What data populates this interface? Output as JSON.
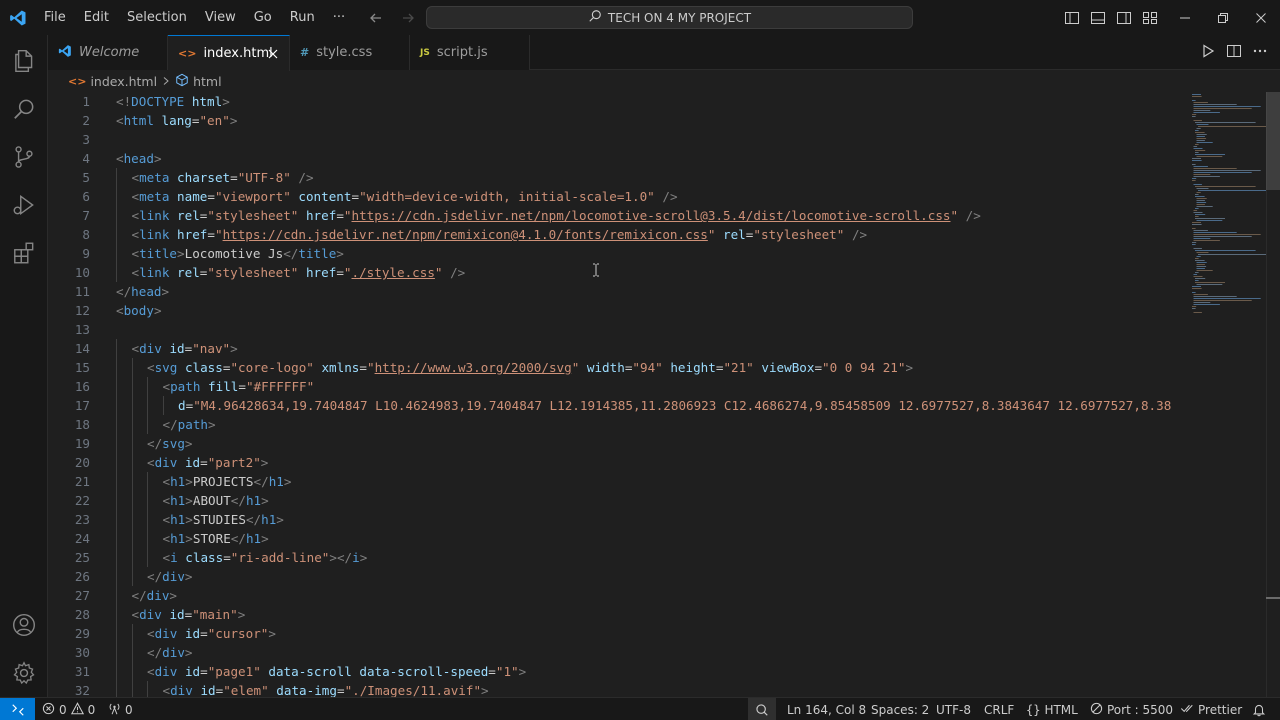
{
  "menu": [
    "File",
    "Edit",
    "Selection",
    "View",
    "Go",
    "Run",
    "···"
  ],
  "command_center": {
    "label": "TECH ON 4 MY PROJECT"
  },
  "tabs": [
    {
      "label": "Welcome",
      "icon": "vscode-logo-icon",
      "italic": true,
      "active": false
    },
    {
      "label": "index.html",
      "icon": "html-file-icon",
      "italic": false,
      "active": true
    },
    {
      "label": "style.css",
      "icon": "css-file-icon",
      "italic": false,
      "active": false
    },
    {
      "label": "script.js",
      "icon": "js-file-icon",
      "italic": false,
      "active": false
    }
  ],
  "tab_icons": {
    "html": "<>",
    "css": "#",
    "js": "JS"
  },
  "breadcrumb": {
    "file": "index.html",
    "symbol": "html"
  },
  "code": [
    {
      "n": "1",
      "tokens": [
        [
          "br",
          "<!"
        ],
        [
          "tag",
          "DOCTYPE"
        ],
        [
          "text",
          " "
        ],
        [
          "attr",
          "html"
        ],
        [
          "br",
          ">"
        ]
      ]
    },
    {
      "n": "2",
      "tokens": [
        [
          "br",
          "<"
        ],
        [
          "tag",
          "html"
        ],
        [
          "text",
          " "
        ],
        [
          "attr",
          "lang"
        ],
        [
          "text",
          "="
        ],
        [
          "str",
          "\"en\""
        ],
        [
          "br",
          ">"
        ]
      ]
    },
    {
      "n": "3",
      "tokens": []
    },
    {
      "n": "4",
      "tokens": [
        [
          "br",
          "<"
        ],
        [
          "tag",
          "head"
        ],
        [
          "br",
          ">"
        ]
      ]
    },
    {
      "n": "5",
      "indent": 1,
      "tokens": [
        [
          "br",
          "<"
        ],
        [
          "tag",
          "meta"
        ],
        [
          "text",
          " "
        ],
        [
          "attr",
          "charset"
        ],
        [
          "text",
          "="
        ],
        [
          "str",
          "\"UTF-8\""
        ],
        [
          "text",
          " "
        ],
        [
          "br",
          "/>"
        ]
      ]
    },
    {
      "n": "6",
      "indent": 1,
      "tokens": [
        [
          "br",
          "<"
        ],
        [
          "tag",
          "meta"
        ],
        [
          "text",
          " "
        ],
        [
          "attr",
          "name"
        ],
        [
          "text",
          "="
        ],
        [
          "str",
          "\"viewport\""
        ],
        [
          "text",
          " "
        ],
        [
          "attr",
          "content"
        ],
        [
          "text",
          "="
        ],
        [
          "str",
          "\"width=device-width, initial-scale=1.0\""
        ],
        [
          "text",
          " "
        ],
        [
          "br",
          "/>"
        ]
      ]
    },
    {
      "n": "7",
      "indent": 1,
      "tokens": [
        [
          "br",
          "<"
        ],
        [
          "tag",
          "link"
        ],
        [
          "text",
          " "
        ],
        [
          "attr",
          "rel"
        ],
        [
          "text",
          "="
        ],
        [
          "str",
          "\"stylesheet\""
        ],
        [
          "text",
          " "
        ],
        [
          "attr",
          "href"
        ],
        [
          "text",
          "="
        ],
        [
          "str",
          "\""
        ],
        [
          "link",
          "https://cdn.jsdelivr.net/npm/locomotive-scroll@3.5.4/dist/locomotive-scroll.css"
        ],
        [
          "str",
          "\""
        ],
        [
          "text",
          " "
        ],
        [
          "br",
          "/>"
        ]
      ]
    },
    {
      "n": "8",
      "indent": 1,
      "tokens": [
        [
          "br",
          "<"
        ],
        [
          "tag",
          "link"
        ],
        [
          "text",
          " "
        ],
        [
          "attr",
          "href"
        ],
        [
          "text",
          "="
        ],
        [
          "str",
          "\""
        ],
        [
          "link",
          "https://cdn.jsdelivr.net/npm/remixicon@4.1.0/fonts/remixicon.css"
        ],
        [
          "str",
          "\""
        ],
        [
          "text",
          " "
        ],
        [
          "attr",
          "rel"
        ],
        [
          "text",
          "="
        ],
        [
          "str",
          "\"stylesheet\""
        ],
        [
          "text",
          " "
        ],
        [
          "br",
          "/>"
        ]
      ]
    },
    {
      "n": "9",
      "indent": 1,
      "tokens": [
        [
          "br",
          "<"
        ],
        [
          "tag",
          "title"
        ],
        [
          "br",
          ">"
        ],
        [
          "text",
          "Locomotive Js"
        ],
        [
          "br",
          "</"
        ],
        [
          "tag",
          "title"
        ],
        [
          "br",
          ">"
        ]
      ]
    },
    {
      "n": "10",
      "indent": 1,
      "tokens": [
        [
          "br",
          "<"
        ],
        [
          "tag",
          "link"
        ],
        [
          "text",
          " "
        ],
        [
          "attr",
          "rel"
        ],
        [
          "text",
          "="
        ],
        [
          "str",
          "\"stylesheet\""
        ],
        [
          "text",
          " "
        ],
        [
          "attr",
          "href"
        ],
        [
          "text",
          "="
        ],
        [
          "str",
          "\""
        ],
        [
          "link",
          "./style.css"
        ],
        [
          "str",
          "\""
        ],
        [
          "text",
          " "
        ],
        [
          "br",
          "/>"
        ]
      ]
    },
    {
      "n": "11",
      "tokens": [
        [
          "br",
          "</"
        ],
        [
          "tag",
          "head"
        ],
        [
          "br",
          ">"
        ]
      ]
    },
    {
      "n": "12",
      "tokens": [
        [
          "br",
          "<"
        ],
        [
          "tag",
          "body"
        ],
        [
          "br",
          ">"
        ]
      ]
    },
    {
      "n": "13",
      "tokens": []
    },
    {
      "n": "14",
      "indent": 1,
      "tokens": [
        [
          "br",
          "<"
        ],
        [
          "tag",
          "div"
        ],
        [
          "text",
          " "
        ],
        [
          "attr",
          "id"
        ],
        [
          "text",
          "="
        ],
        [
          "str",
          "\"nav\""
        ],
        [
          "br",
          ">"
        ]
      ]
    },
    {
      "n": "15",
      "indent": 2,
      "tokens": [
        [
          "br",
          "<"
        ],
        [
          "tag",
          "svg"
        ],
        [
          "text",
          " "
        ],
        [
          "attr",
          "class"
        ],
        [
          "text",
          "="
        ],
        [
          "str",
          "\"core-logo\""
        ],
        [
          "text",
          " "
        ],
        [
          "attr",
          "xmlns"
        ],
        [
          "text",
          "="
        ],
        [
          "str",
          "\""
        ],
        [
          "link",
          "http://www.w3.org/2000/svg"
        ],
        [
          "str",
          "\""
        ],
        [
          "text",
          " "
        ],
        [
          "attr",
          "width"
        ],
        [
          "text",
          "="
        ],
        [
          "str",
          "\"94\""
        ],
        [
          "text",
          " "
        ],
        [
          "attr",
          "height"
        ],
        [
          "text",
          "="
        ],
        [
          "str",
          "\"21\""
        ],
        [
          "text",
          " "
        ],
        [
          "attr",
          "viewBox"
        ],
        [
          "text",
          "="
        ],
        [
          "str",
          "\"0 0 94 21\""
        ],
        [
          "br",
          ">"
        ]
      ]
    },
    {
      "n": "16",
      "indent": 3,
      "tokens": [
        [
          "br",
          "<"
        ],
        [
          "tag",
          "path"
        ],
        [
          "text",
          " "
        ],
        [
          "attr",
          "fill"
        ],
        [
          "text",
          "="
        ],
        [
          "str",
          "\"#FFFFFF\""
        ]
      ]
    },
    {
      "n": "17",
      "indent": 4,
      "tokens": [
        [
          "attr",
          "d"
        ],
        [
          "text",
          "="
        ],
        [
          "str",
          "\"M4.96428634,19.7404847 L10.4624983,19.7404847 L12.1914385,11.2806923 C12.4686274,9.85458509 12.6977527,8.3843647 12.6977527,8.38"
        ]
      ]
    },
    {
      "n": "18",
      "indent": 3,
      "tokens": [
        [
          "br",
          "</"
        ],
        [
          "tag",
          "path"
        ],
        [
          "br",
          ">"
        ]
      ]
    },
    {
      "n": "19",
      "indent": 2,
      "tokens": [
        [
          "br",
          "</"
        ],
        [
          "tag",
          "svg"
        ],
        [
          "br",
          ">"
        ]
      ]
    },
    {
      "n": "20",
      "indent": 2,
      "tokens": [
        [
          "br",
          "<"
        ],
        [
          "tag",
          "div"
        ],
        [
          "text",
          " "
        ],
        [
          "attr",
          "id"
        ],
        [
          "text",
          "="
        ],
        [
          "str",
          "\"part2\""
        ],
        [
          "br",
          ">"
        ]
      ]
    },
    {
      "n": "21",
      "indent": 3,
      "tokens": [
        [
          "br",
          "<"
        ],
        [
          "tag",
          "h1"
        ],
        [
          "br",
          ">"
        ],
        [
          "text",
          "PROJECTS"
        ],
        [
          "br",
          "</"
        ],
        [
          "tag",
          "h1"
        ],
        [
          "br",
          ">"
        ]
      ]
    },
    {
      "n": "22",
      "indent": 3,
      "tokens": [
        [
          "br",
          "<"
        ],
        [
          "tag",
          "h1"
        ],
        [
          "br",
          ">"
        ],
        [
          "text",
          "ABOUT"
        ],
        [
          "br",
          "</"
        ],
        [
          "tag",
          "h1"
        ],
        [
          "br",
          ">"
        ]
      ]
    },
    {
      "n": "23",
      "indent": 3,
      "tokens": [
        [
          "br",
          "<"
        ],
        [
          "tag",
          "h1"
        ],
        [
          "br",
          ">"
        ],
        [
          "text",
          "STUDIES"
        ],
        [
          "br",
          "</"
        ],
        [
          "tag",
          "h1"
        ],
        [
          "br",
          ">"
        ]
      ]
    },
    {
      "n": "24",
      "indent": 3,
      "tokens": [
        [
          "br",
          "<"
        ],
        [
          "tag",
          "h1"
        ],
        [
          "br",
          ">"
        ],
        [
          "text",
          "STORE"
        ],
        [
          "br",
          "</"
        ],
        [
          "tag",
          "h1"
        ],
        [
          "br",
          ">"
        ]
      ]
    },
    {
      "n": "25",
      "indent": 3,
      "tokens": [
        [
          "br",
          "<"
        ],
        [
          "tag",
          "i"
        ],
        [
          "text",
          " "
        ],
        [
          "attr",
          "class"
        ],
        [
          "text",
          "="
        ],
        [
          "str",
          "\"ri-add-line\""
        ],
        [
          "br",
          "></"
        ],
        [
          "tag",
          "i"
        ],
        [
          "br",
          ">"
        ]
      ]
    },
    {
      "n": "26",
      "indent": 2,
      "tokens": [
        [
          "br",
          "</"
        ],
        [
          "tag",
          "div"
        ],
        [
          "br",
          ">"
        ]
      ]
    },
    {
      "n": "27",
      "indent": 1,
      "tokens": [
        [
          "br",
          "</"
        ],
        [
          "tag",
          "div"
        ],
        [
          "br",
          ">"
        ]
      ]
    },
    {
      "n": "28",
      "indent": 1,
      "tokens": [
        [
          "br",
          "<"
        ],
        [
          "tag",
          "div"
        ],
        [
          "text",
          " "
        ],
        [
          "attr",
          "id"
        ],
        [
          "text",
          "="
        ],
        [
          "str",
          "\"main\""
        ],
        [
          "br",
          ">"
        ]
      ]
    },
    {
      "n": "29",
      "indent": 2,
      "tokens": [
        [
          "br",
          "<"
        ],
        [
          "tag",
          "div"
        ],
        [
          "text",
          " "
        ],
        [
          "attr",
          "id"
        ],
        [
          "text",
          "="
        ],
        [
          "str",
          "\"cursor\""
        ],
        [
          "br",
          ">"
        ]
      ]
    },
    {
      "n": "30",
      "indent": 2,
      "tokens": [
        [
          "br",
          "</"
        ],
        [
          "tag",
          "div"
        ],
        [
          "br",
          ">"
        ]
      ]
    },
    {
      "n": "31",
      "indent": 2,
      "tokens": [
        [
          "br",
          "<"
        ],
        [
          "tag",
          "div"
        ],
        [
          "text",
          " "
        ],
        [
          "attr",
          "id"
        ],
        [
          "text",
          "="
        ],
        [
          "str",
          "\"page1\""
        ],
        [
          "text",
          " "
        ],
        [
          "attr",
          "data-scroll"
        ],
        [
          "text",
          " "
        ],
        [
          "attr",
          "data-scroll-speed"
        ],
        [
          "text",
          "="
        ],
        [
          "str",
          "\"1\""
        ],
        [
          "br",
          ">"
        ]
      ]
    },
    {
      "n": "32",
      "indent": 3,
      "tokens": [
        [
          "br",
          "<"
        ],
        [
          "tag",
          "div"
        ],
        [
          "text",
          " "
        ],
        [
          "attr",
          "id"
        ],
        [
          "text",
          "="
        ],
        [
          "str",
          "\"elem\""
        ],
        [
          "text",
          " "
        ],
        [
          "attr",
          "data-img"
        ],
        [
          "text",
          "="
        ],
        [
          "str",
          "\"./Images/11.avif\""
        ],
        [
          "br",
          ">"
        ]
      ]
    }
  ],
  "status": {
    "errors": "0",
    "warnings": "0",
    "ports": "0",
    "position": "Ln 164, Col 8",
    "spaces": "Spaces: 2",
    "encoding": "UTF-8",
    "eol": "CRLF",
    "language": "HTML",
    "port": "Port : 5500",
    "prettier": "Prettier"
  },
  "colors": {
    "accent": "#0078d4",
    "tag": "#569cd6",
    "attr": "#9cdcfe",
    "string": "#ce9178",
    "html_icon": "#e37933",
    "css_icon": "#519aba",
    "js_icon": "#cbcb41"
  }
}
